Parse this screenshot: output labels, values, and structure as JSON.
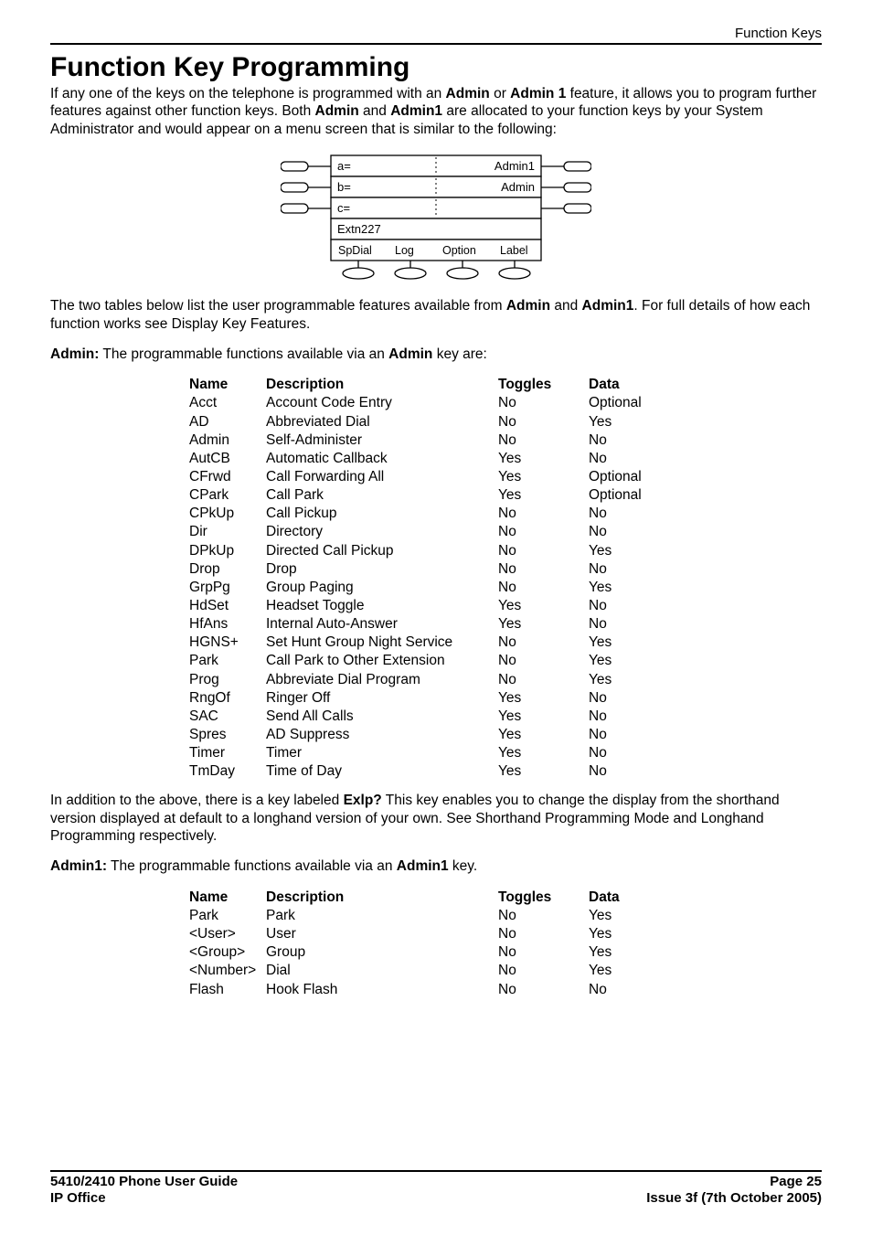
{
  "header": {
    "right": "Function Keys"
  },
  "title": "Function Key Programming",
  "intro_parts": {
    "p1a": "If any one of the keys on the telephone is programmed with an ",
    "p1b": "Admin",
    "p1c": " or ",
    "p1d": "Admin 1",
    "p1e": " feature, it allows you to program further features against other function keys. Both ",
    "p1f": "Admin",
    "p1g": " and ",
    "p1h": "Admin1",
    "p1i": " are allocated to your function keys by your System Administrator and would appear on a menu screen that is similar to the following:"
  },
  "diagram": {
    "row_a_left": "a=",
    "row_a_right": "Admin1",
    "row_b_left": "b=",
    "row_b_right": "Admin",
    "row_c_left": "c=",
    "row_c_right": "",
    "extn": "Extn227",
    "sk1": "SpDial",
    "sk2": "Log",
    "sk3": "Option",
    "sk4": "Label"
  },
  "para2": {
    "a": "The two tables below list the user programmable features available from ",
    "b": "Admin",
    "c": " and ",
    "d": "Admin1",
    "e": ". For full details of how each function works see Display Key Features."
  },
  "admin_head": {
    "a": "Admin:",
    "b": " The programmable functions available via an ",
    "c": "Admin",
    "d": " key are:"
  },
  "table_headers": {
    "name": "Name",
    "desc": "Description",
    "tog": "Toggles",
    "data": "Data"
  },
  "admin_rows": [
    {
      "n": "Acct",
      "d": "Account Code Entry",
      "t": "No",
      "x": "Optional"
    },
    {
      "n": "AD",
      "d": "Abbreviated Dial",
      "t": "No",
      "x": "Yes"
    },
    {
      "n": "Admin",
      "d": "Self-Administer",
      "t": "No",
      "x": "No"
    },
    {
      "n": "AutCB",
      "d": "Automatic Callback",
      "t": "Yes",
      "x": "No"
    },
    {
      "n": "CFrwd",
      "d": "Call Forwarding All",
      "t": "Yes",
      "x": "Optional"
    },
    {
      "n": "CPark",
      "d": "Call Park",
      "t": "Yes",
      "x": "Optional"
    },
    {
      "n": "CPkUp",
      "d": "Call Pickup",
      "t": "No",
      "x": "No"
    },
    {
      "n": "Dir",
      "d": "Directory",
      "t": "No",
      "x": "No"
    },
    {
      "n": "DPkUp",
      "d": "Directed Call Pickup",
      "t": "No",
      "x": "Yes"
    },
    {
      "n": "Drop",
      "d": "Drop",
      "t": "No",
      "x": "No"
    },
    {
      "n": "GrpPg",
      "d": "Group Paging",
      "t": "No",
      "x": "Yes"
    },
    {
      "n": "HdSet",
      "d": "Headset Toggle",
      "t": "Yes",
      "x": "No"
    },
    {
      "n": "HfAns",
      "d": "Internal Auto-Answer",
      "t": "Yes",
      "x": "No"
    },
    {
      "n": "HGNS+",
      "d": "Set Hunt Group Night Service",
      "t": "No",
      "x": "Yes"
    },
    {
      "n": "Park",
      "d": "Call Park to Other Extension",
      "t": "No",
      "x": "Yes"
    },
    {
      "n": "Prog",
      "d": "Abbreviate Dial Program",
      "t": "No",
      "x": "Yes"
    },
    {
      "n": "RngOf",
      "d": "Ringer Off",
      "t": "Yes",
      "x": "No"
    },
    {
      "n": "SAC",
      "d": "Send All Calls",
      "t": "Yes",
      "x": "No"
    },
    {
      "n": "Spres",
      "d": "AD Suppress",
      "t": "Yes",
      "x": "No"
    },
    {
      "n": "Timer",
      "d": "Timer",
      "t": "Yes",
      "x": "No"
    },
    {
      "n": "TmDay",
      "d": "Time of Day",
      "t": "Yes",
      "x": "No"
    }
  ],
  "para3": {
    "a": "In addition to the above, there is a key labeled ",
    "b": "Exlp?",
    "c": " This key enables you to change the display from the shorthand version displayed at default to a longhand version of your own. See Shorthand Programming Mode and Longhand Programming respectively."
  },
  "admin1_head": {
    "a": "Admin1:",
    "b": " The programmable functions available via an ",
    "c": "Admin1",
    "d": " key."
  },
  "admin1_rows": [
    {
      "n": "Park",
      "d": "Park",
      "t": "No",
      "x": "Yes"
    },
    {
      "n": "<User>",
      "d": "User",
      "t": "No",
      "x": "Yes"
    },
    {
      "n": "<Group>",
      "d": "Group",
      "t": "No",
      "x": "Yes"
    },
    {
      "n": "<Number>",
      "d": "Dial",
      "t": "No",
      "x": "Yes"
    },
    {
      "n": "Flash",
      "d": "Hook Flash",
      "t": "No",
      "x": "No"
    }
  ],
  "footer": {
    "left1": "5410/2410 Phone User Guide",
    "left2": "IP Office",
    "right1": "Page 25",
    "right2": "Issue 3f (7th October 2005)"
  }
}
